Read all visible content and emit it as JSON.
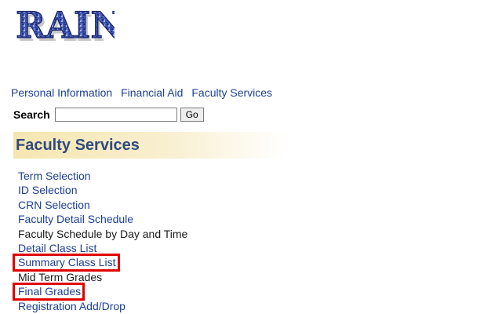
{
  "logo": {
    "alt": "RAIN"
  },
  "topnav": {
    "items": [
      "Personal Information",
      "Financial Aid",
      "Faculty Services"
    ]
  },
  "search": {
    "label": "Search",
    "value": "",
    "placeholder": "",
    "go_label": "Go"
  },
  "banner": {
    "title": "Faculty Services"
  },
  "menu": {
    "items": [
      "Term Selection",
      "ID Selection",
      "CRN Selection",
      "Faculty Detail Schedule",
      "Faculty Schedule by Day and Time",
      "Detail Class List",
      "Summary Class List",
      "Mid Term Grades",
      "Final Grades",
      "Registration Add/Drop"
    ]
  },
  "highlights": {
    "color": "#e00000",
    "items": [
      "Summary Class List",
      "Final Grades"
    ]
  },
  "colors": {
    "link": "#1c3f94",
    "banner_title": "#2f4a7e",
    "banner_bg": "#f5e6b0"
  }
}
